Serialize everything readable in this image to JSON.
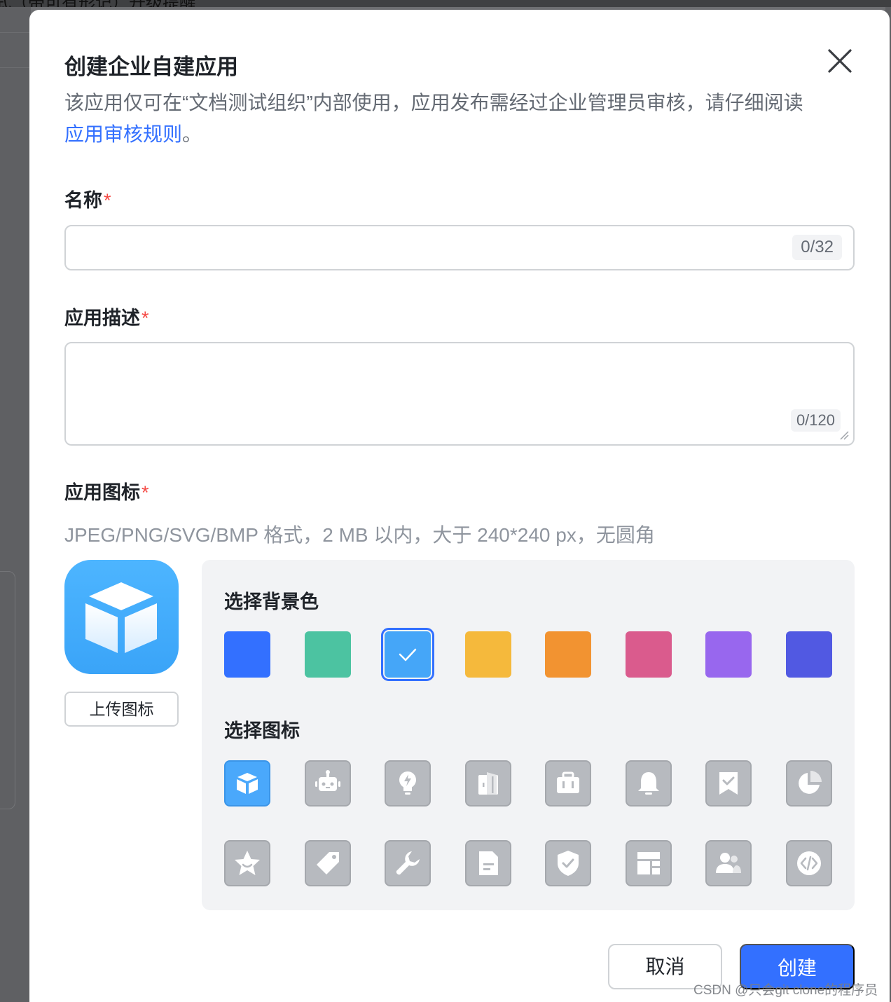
{
  "background": {
    "top_text": "式（带可有形记）升级提醒"
  },
  "dialog": {
    "title": "创建企业自建应用",
    "description_pre": "该应用仅可在“文档测试组织”内部使用，应用发布需经过企业管理员审核，请仔细阅读",
    "description_link": "应用审核规则",
    "description_post": "。"
  },
  "name_field": {
    "label": "名称",
    "required": "*",
    "value": "",
    "counter": "0/32"
  },
  "desc_field": {
    "label": "应用描述",
    "required": "*",
    "value": "",
    "counter": "0/120"
  },
  "icon_field": {
    "label": "应用图标",
    "required": "*",
    "hint": "JPEG/PNG/SVG/BMP 格式，2 MB 以内，大于 240*240 px，无圆角",
    "upload_label": "上传图标",
    "preview_icon": "cube-icon"
  },
  "picker": {
    "bg_title": "选择背景色",
    "icon_title": "选择图标",
    "colors": [
      "#3370ff",
      "#4cc3a1",
      "#45a6f8",
      "#f5b93c",
      "#f29331",
      "#da5b8d",
      "#9867ee",
      "#5159e2"
    ],
    "selected_color_index": 2,
    "icons": [
      "cube-icon",
      "robot-icon",
      "lightbulb-icon",
      "door-icon",
      "briefcase-icon",
      "bell-icon",
      "bookmark-check-icon",
      "pie-chart-icon",
      "star-icon",
      "tag-icon",
      "wrench-icon",
      "document-icon",
      "shield-check-icon",
      "layout-icon",
      "users-icon",
      "code-icon"
    ],
    "selected_icon_index": 0
  },
  "footer": {
    "cancel_label": "取消",
    "create_label": "创建"
  },
  "watermark": "CSDN @只会git clone的程序员"
}
